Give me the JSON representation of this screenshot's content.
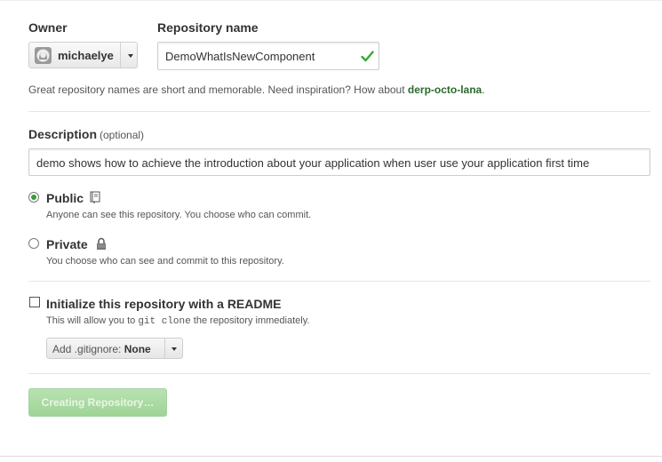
{
  "owner": {
    "label": "Owner",
    "username": "michaelye"
  },
  "repository": {
    "label": "Repository name",
    "value": "DemoWhatIsNewComponent"
  },
  "hint": {
    "text": "Great repository names are short and memorable. Need inspiration? How about ",
    "suggestion": "derp-octo-lana",
    "end": "."
  },
  "description": {
    "label": "Description",
    "optional": "(optional)",
    "value": "demo shows how to achieve the introduction about your application when user use your application first time"
  },
  "visibility": {
    "public": {
      "title": "Public",
      "subtitle": "Anyone can see this repository. You choose who can commit.",
      "selected": true
    },
    "private": {
      "title": "Private",
      "subtitle": "You choose who can see and commit to this repository.",
      "selected": false
    }
  },
  "readme": {
    "title": "Initialize this repository with a README",
    "sub_before": "This will allow you to ",
    "sub_code": "git clone",
    "sub_after": " the repository immediately.",
    "checked": false
  },
  "gitignore": {
    "label": "Add .gitignore:",
    "value": "None"
  },
  "create_button": {
    "label": "Creating Repository…"
  },
  "colors": {
    "accent_green": "#3a9a3a",
    "suggestion_green": "#2a6b2a",
    "button_green": "#a9d9a0"
  },
  "icons": {
    "avatar": "octocat-avatar-icon",
    "valid": "checkmark-icon",
    "public": "book-repo-icon",
    "private": "lock-icon"
  }
}
